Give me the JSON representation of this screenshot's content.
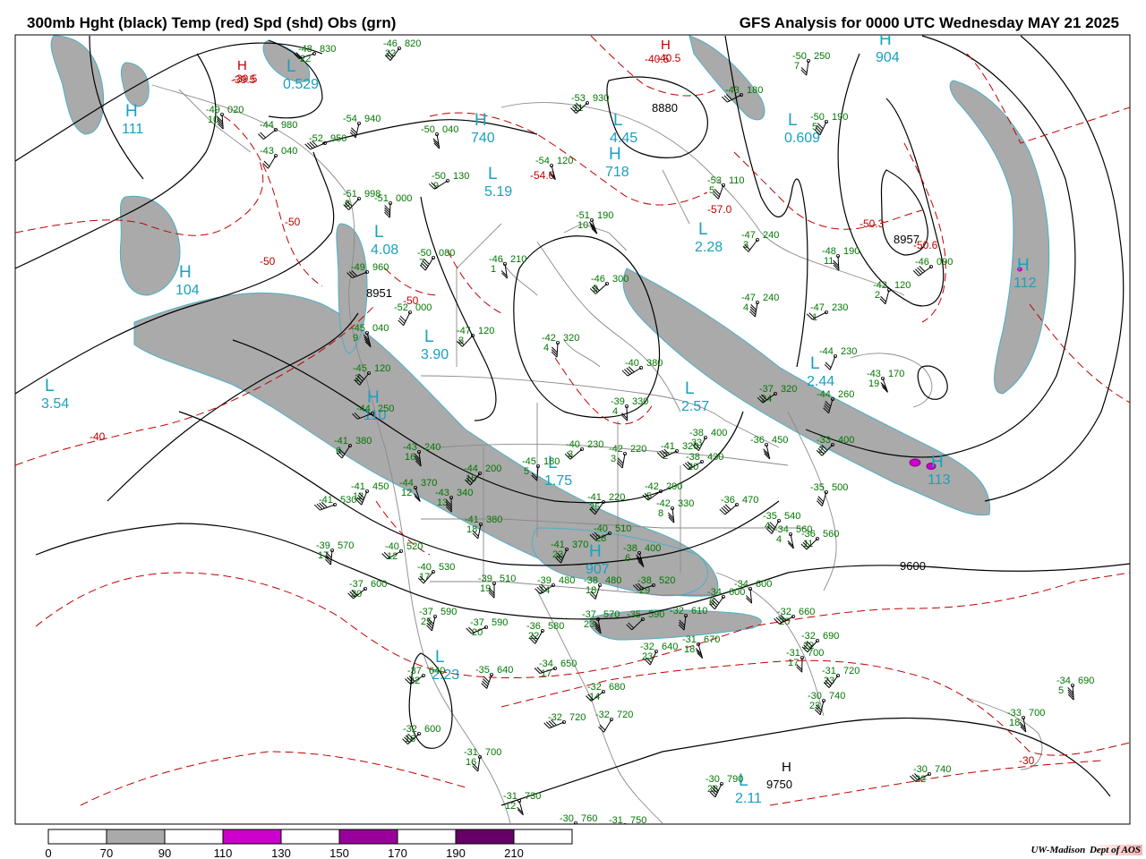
{
  "header": {
    "left_title": "300mb Hght (black) Temp (red) Spd (shd) Obs (grn)",
    "right_title": "GFS Analysis for 0000 UTC Wednesday  MAY 21 2025"
  },
  "colors": {
    "height_contour": "#000000",
    "temp_contour": "#c00000",
    "wind_shade_70_90": "#aaaaaa",
    "wind_shade_110_130": "#cc00cc",
    "wind_shade_150_170": "#990099",
    "wind_shade_190_210": "#660066",
    "observation": "#007700",
    "pressure_center": "#1aa0c0",
    "geography": "#888888"
  },
  "legend": {
    "ticks": [
      "0",
      "70",
      "90",
      "110",
      "130",
      "150",
      "170",
      "190",
      "210"
    ]
  },
  "credit": {
    "org": "UW-Madison",
    "dept": "Dept of AOS"
  },
  "contour_labels": {
    "height": [
      "8880",
      "8951",
      "8957",
      "9600",
      "9750"
    ],
    "temp": [
      "-40.5",
      "-39.5",
      "-54.0",
      "-57.0",
      "-50.3",
      "-50.6",
      "-50",
      "-50",
      "-40",
      "-30",
      "-50"
    ]
  },
  "centers": [
    {
      "letter": "H",
      "value": "111"
    },
    {
      "letter": "L",
      "value": "0.529"
    },
    {
      "letter": "H",
      "value": "740"
    },
    {
      "letter": "L",
      "value": "4.45"
    },
    {
      "letter": "H",
      "value": "718"
    },
    {
      "letter": "H",
      "value": "904"
    },
    {
      "letter": "L",
      "value": "0.609"
    },
    {
      "letter": "L",
      "value": "5.19"
    },
    {
      "letter": "L",
      "value": "4.08"
    },
    {
      "letter": "L",
      "value": "2.28"
    },
    {
      "letter": "H",
      "value": "104"
    },
    {
      "letter": "L",
      "value": "3.90"
    },
    {
      "letter": "H",
      "value": "112"
    },
    {
      "letter": "L",
      "value": "3.54"
    },
    {
      "letter": "L",
      "value": "2.44"
    },
    {
      "letter": "L",
      "value": "2.57"
    },
    {
      "letter": "H",
      "value": "110"
    },
    {
      "letter": "H",
      "value": "113"
    },
    {
      "letter": "L",
      "value": "1.75"
    },
    {
      "letter": "H",
      "value": "907"
    },
    {
      "letter": "L",
      "value": "2.23"
    },
    {
      "letter": "L",
      "value": "2.11"
    },
    {
      "letter": "H",
      "value": "9750"
    },
    {
      "letter": "H",
      "value": "-39.5"
    },
    {
      "letter": "H",
      "value": "-40.5"
    }
  ],
  "observations": [
    {
      "t": "-48",
      "h": "830",
      "td": "22"
    },
    {
      "t": "-46",
      "h": "820",
      "td": "22"
    },
    {
      "t": "-49",
      "h": "020",
      "td": "10"
    },
    {
      "t": "-44",
      "h": "980",
      "td": ""
    },
    {
      "t": "-54",
      "h": "940",
      "td": ""
    },
    {
      "t": "-52",
      "h": "950",
      "td": ""
    },
    {
      "t": "-43",
      "h": "040",
      "td": ""
    },
    {
      "t": "-50",
      "h": "040",
      "td": ""
    },
    {
      "t": "-53",
      "h": "930",
      "td": "11"
    },
    {
      "t": "-50",
      "h": "250",
      "td": "7"
    },
    {
      "t": "-43",
      "h": "180",
      "td": ""
    },
    {
      "t": "-50",
      "h": "190",
      "td": "5"
    },
    {
      "t": "-54",
      "h": "120",
      "td": ""
    },
    {
      "t": "-51",
      "h": "998",
      "td": "8"
    },
    {
      "t": "-51",
      "h": "000",
      "td": ""
    },
    {
      "t": "-50",
      "h": "130",
      "td": "9"
    },
    {
      "t": "-53",
      "h": "110",
      "td": "5"
    },
    {
      "t": "-51",
      "h": "190",
      "td": "10"
    },
    {
      "t": "-47",
      "h": "240",
      "td": "3"
    },
    {
      "t": "-48",
      "h": "190",
      "td": "11"
    },
    {
      "t": "-46",
      "h": "090",
      "td": ""
    },
    {
      "t": "-42",
      "h": "120",
      "td": "2"
    },
    {
      "t": "-49",
      "h": "960",
      "td": ""
    },
    {
      "t": "-50",
      "h": "080",
      "td": "7"
    },
    {
      "t": "-46",
      "h": "210",
      "td": "1"
    },
    {
      "t": "-46",
      "h": "300",
      "td": "9"
    },
    {
      "t": "-47",
      "h": "240",
      "td": "4"
    },
    {
      "t": "-47",
      "h": "230",
      "td": "1"
    },
    {
      "t": "-52",
      "h": "000",
      "td": ""
    },
    {
      "t": "-45",
      "h": "040",
      "td": "9"
    },
    {
      "t": "-47",
      "h": "120",
      "td": "3"
    },
    {
      "t": "-42",
      "h": "320",
      "td": "4"
    },
    {
      "t": "-40",
      "h": "380",
      "td": ""
    },
    {
      "t": "-44",
      "h": "230",
      "td": ""
    },
    {
      "t": "-43",
      "h": "170",
      "td": "19"
    },
    {
      "t": "-45",
      "h": "120",
      "td": "2"
    },
    {
      "t": "-39",
      "h": "330",
      "td": "4"
    },
    {
      "t": "-37",
      "h": "320",
      "td": "24"
    },
    {
      "t": "-44",
      "h": "260",
      "td": ""
    },
    {
      "t": "-44",
      "h": "250",
      "td": ""
    },
    {
      "t": "-41",
      "h": "380",
      "td": "6"
    },
    {
      "t": "-43",
      "h": "240",
      "td": "16"
    },
    {
      "t": "-40",
      "h": "230",
      "td": "3"
    },
    {
      "t": "-42",
      "h": "220",
      "td": "3"
    },
    {
      "t": "-41",
      "h": "320",
      "td": "2"
    },
    {
      "t": "-38",
      "h": "400",
      "td": "33"
    },
    {
      "t": "-36",
      "h": "450",
      "td": ""
    },
    {
      "t": "-33",
      "h": "400",
      "td": "2"
    },
    {
      "t": "-45",
      "h": "180",
      "td": "5"
    },
    {
      "t": "-38",
      "h": "430",
      "td": "20"
    },
    {
      "t": "-41",
      "h": "450",
      "td": "12"
    },
    {
      "t": "-44",
      "h": "370",
      "td": "12"
    },
    {
      "t": "-44",
      "h": "200",
      "td": "16"
    },
    {
      "t": "-43",
      "h": "340",
      "td": "13"
    },
    {
      "t": "-42",
      "h": "290",
      "td": "5"
    },
    {
      "t": "-35",
      "h": "500",
      "td": ""
    },
    {
      "t": "-41",
      "h": "530",
      "td": ""
    },
    {
      "t": "-41",
      "h": "220",
      "td": "25"
    },
    {
      "t": "-42",
      "h": "330",
      "td": "8"
    },
    {
      "t": "-36",
      "h": "470",
      "td": ""
    },
    {
      "t": "-41",
      "h": "380",
      "td": "18"
    },
    {
      "t": "-40",
      "h": "510",
      "td": "28"
    },
    {
      "t": "-35",
      "h": "540",
      "td": "4"
    },
    {
      "t": "-34",
      "h": "560",
      "td": "4"
    },
    {
      "t": "-36",
      "h": "560",
      "td": "11"
    },
    {
      "t": "-39",
      "h": "570",
      "td": "17"
    },
    {
      "t": "-40",
      "h": "520",
      "td": "12"
    },
    {
      "t": "-41",
      "h": "370",
      "td": "23"
    },
    {
      "t": "-38",
      "h": "400",
      "td": "6"
    },
    {
      "t": "-40",
      "h": "530",
      "td": "17"
    },
    {
      "t": "-39",
      "h": "510",
      "td": "19"
    },
    {
      "t": "-39",
      "h": "480",
      "td": "14"
    },
    {
      "t": "-38",
      "h": "480",
      "td": "18"
    },
    {
      "t": "-38",
      "h": "520",
      "td": "29"
    },
    {
      "t": "-34",
      "h": "600",
      "td": "6"
    },
    {
      "t": "-34",
      "h": "600",
      "td": ""
    },
    {
      "t": "-37",
      "h": "600",
      "td": "30"
    },
    {
      "t": "-37",
      "h": "590",
      "td": "25"
    },
    {
      "t": "-37",
      "h": "590",
      "td": "20"
    },
    {
      "t": "-36",
      "h": "580",
      "td": "22"
    },
    {
      "t": "-37",
      "h": "570",
      "td": "23"
    },
    {
      "t": "-35",
      "h": "590",
      "td": ""
    },
    {
      "t": "-32",
      "h": "610",
      "td": ""
    },
    {
      "t": "-32",
      "h": "660",
      "td": "20"
    },
    {
      "t": "-32",
      "h": "640",
      "td": "23"
    },
    {
      "t": "-31",
      "h": "670",
      "td": "18"
    },
    {
      "t": "-32",
      "h": "690",
      "td": "22"
    },
    {
      "t": "-31",
      "h": "700",
      "td": "17"
    },
    {
      "t": "-37",
      "h": "640",
      "td": "22"
    },
    {
      "t": "-35",
      "h": "640",
      "td": ""
    },
    {
      "t": "-34",
      "h": "650",
      "td": "17"
    },
    {
      "t": "-31",
      "h": "720",
      "td": "23"
    },
    {
      "t": "-34",
      "h": "690",
      "td": "5"
    },
    {
      "t": "-32",
      "h": "680",
      "td": "14"
    },
    {
      "t": "-30",
      "h": "740",
      "td": "23"
    },
    {
      "t": "-32",
      "h": "720",
      "td": ""
    },
    {
      "t": "-32",
      "h": "720",
      "td": ""
    },
    {
      "t": "-33",
      "h": "700",
      "td": "18"
    },
    {
      "t": "-32",
      "h": "600",
      "td": "16"
    },
    {
      "t": "-31",
      "h": "700",
      "td": "16"
    },
    {
      "t": "-30",
      "h": "740",
      "td": "22"
    },
    {
      "t": "-30",
      "h": "790",
      "td": "28"
    },
    {
      "t": "-31",
      "h": "730",
      "td": "12"
    },
    {
      "t": "-30",
      "h": "760",
      "td": ""
    },
    {
      "t": "-31",
      "h": "750",
      "td": ""
    }
  ]
}
